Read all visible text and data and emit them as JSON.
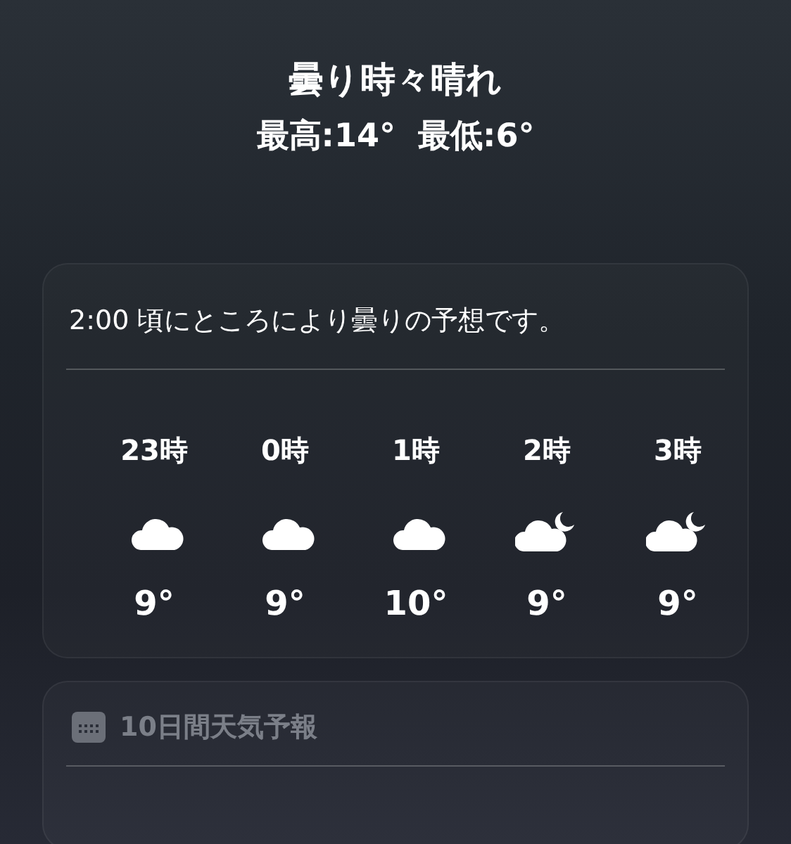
{
  "current": {
    "condition": "曇り時々晴れ",
    "high": "最高:14°",
    "low": "最低:6°"
  },
  "hourly": {
    "message": "2:00 頃にところにより曇りの予想です。",
    "hours": [
      {
        "time": "23時",
        "kind": "cloud",
        "temp": "9°"
      },
      {
        "time": "0時",
        "kind": "cloud",
        "temp": "9°"
      },
      {
        "time": "1時",
        "kind": "cloud",
        "temp": "10°"
      },
      {
        "time": "2時",
        "kind": "cloud-moon",
        "temp": "9°"
      },
      {
        "time": "3時",
        "kind": "cloud-moon",
        "temp": "9°"
      }
    ]
  },
  "forecast": {
    "title": "10日間天気予報"
  }
}
